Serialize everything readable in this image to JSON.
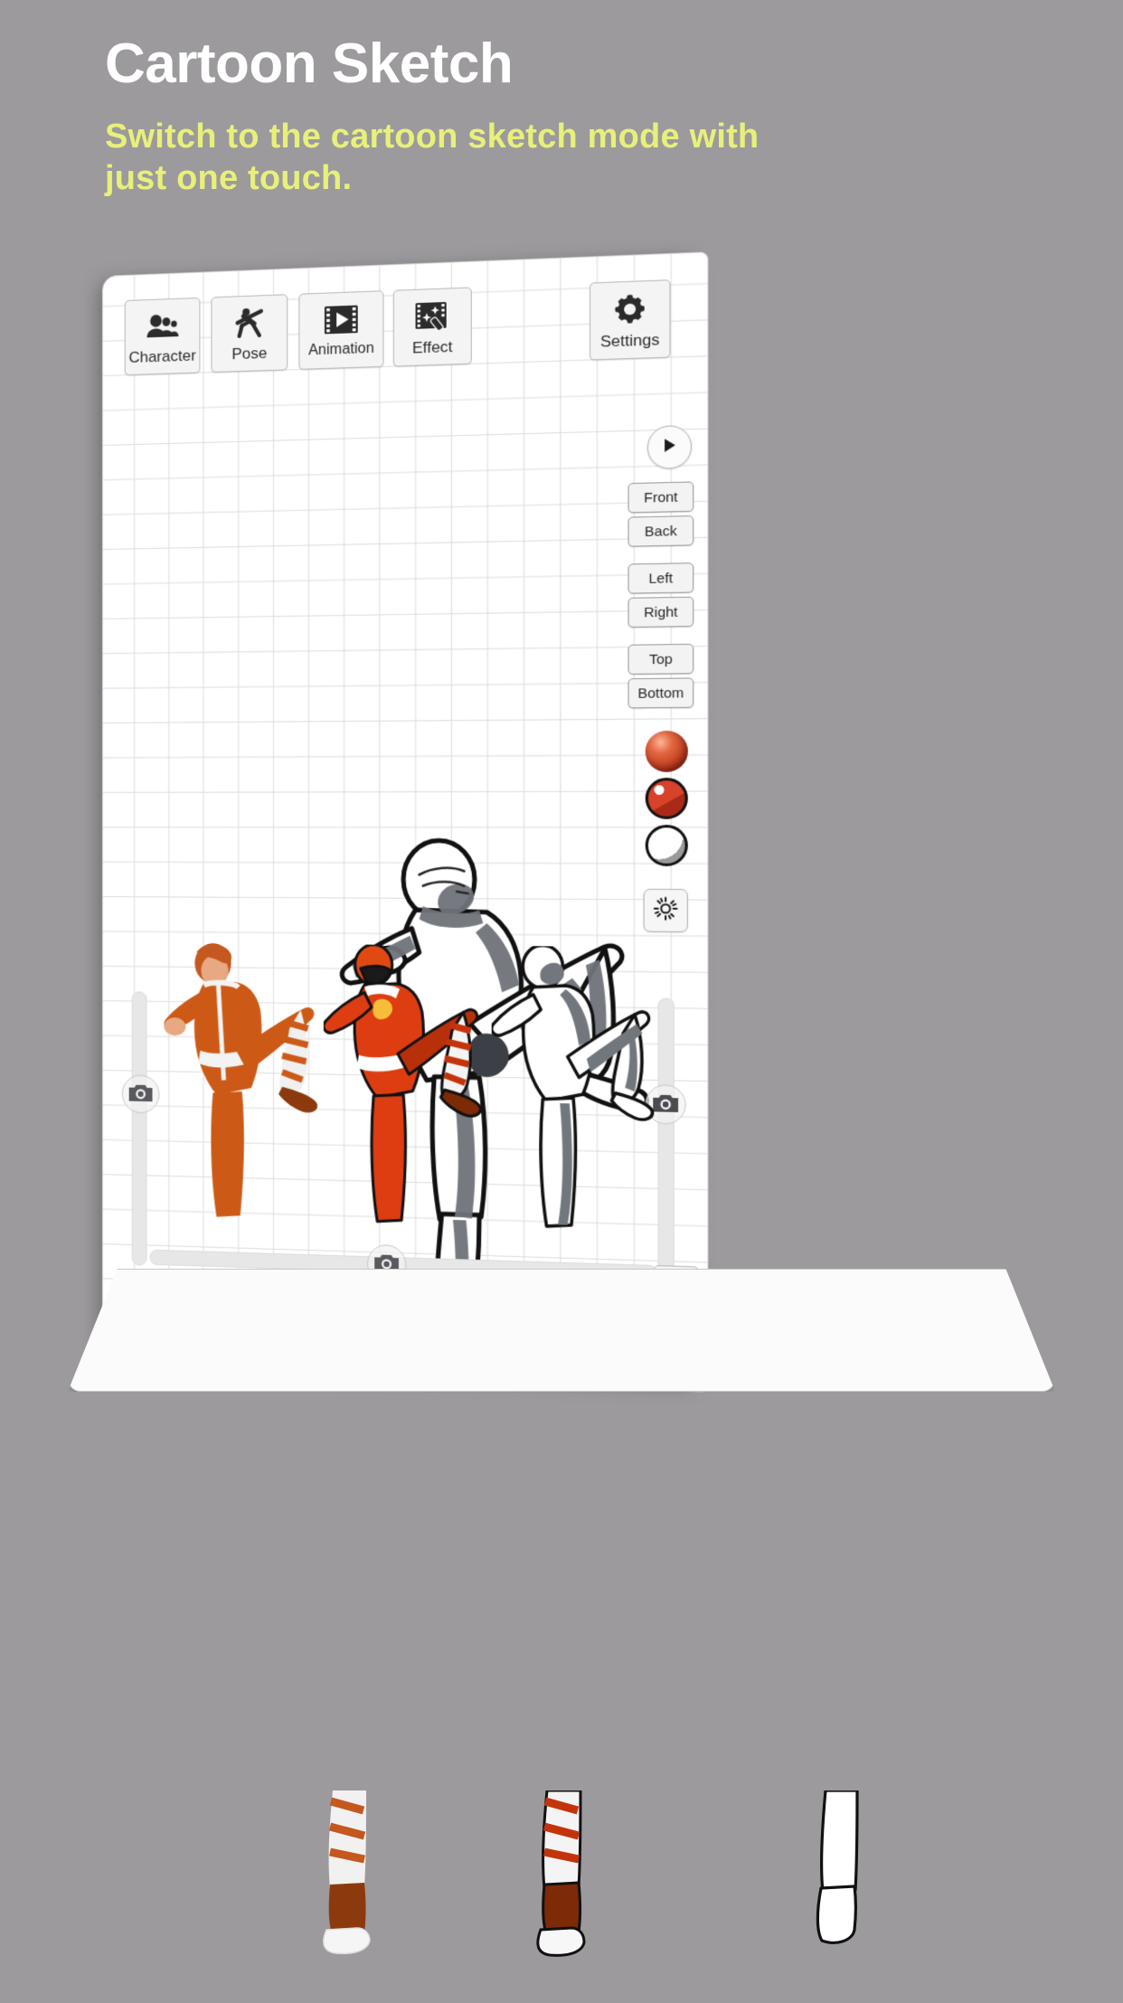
{
  "promo": {
    "title": "Cartoon Sketch",
    "subtitle": "Switch to the cartoon sketch mode with just one touch.",
    "title_color": "#ffffff",
    "subtitle_color": "#e8f07a",
    "background_color": "#9c9a9d"
  },
  "app": {
    "toolbar": [
      {
        "label": "Character",
        "icon": "people-icon"
      },
      {
        "label": "Pose",
        "icon": "pose-figure-icon"
      },
      {
        "label": "Animation",
        "icon": "film-play-icon"
      },
      {
        "label": "Effect",
        "icon": "film-sparkle-wand-icon"
      },
      {
        "label": "Settings",
        "icon": "gear-icon"
      }
    ],
    "playback": {
      "play_label": "▶",
      "icon": "play-icon"
    },
    "view_buttons": [
      "Front",
      "Back",
      "Left",
      "Right",
      "Top",
      "Bottom"
    ],
    "shading_swatches": [
      {
        "name": "realistic-shading",
        "color": "#c2401f",
        "style": "realistic"
      },
      {
        "name": "cartoon-shading",
        "color": "#d8412a",
        "style": "cartoon"
      },
      {
        "name": "sketch-shading",
        "color": "#ffffff",
        "style": "sketch"
      }
    ],
    "light_button": {
      "icon": "sun-icon",
      "label": ""
    },
    "sliders": [
      {
        "name": "left-vertical-slider",
        "icon": "camera-icon",
        "orientation": "vertical"
      },
      {
        "name": "right-vertical-slider",
        "icon": "camera-icon",
        "orientation": "vertical"
      },
      {
        "name": "bottom-horizontal-slider",
        "icon": "camera-icon",
        "orientation": "horizontal"
      }
    ],
    "corner_button": {
      "icon": "pose-tool-icon"
    },
    "figures": [
      {
        "name": "main-figure",
        "style": "cartoon-sketch",
        "pose": "high-kick"
      },
      {
        "name": "thumb-figure-1",
        "style": "realistic",
        "pose": "high-kick"
      },
      {
        "name": "thumb-figure-2",
        "style": "cartoon",
        "pose": "high-kick"
      },
      {
        "name": "thumb-figure-3",
        "style": "sketch",
        "pose": "high-kick"
      }
    ]
  }
}
